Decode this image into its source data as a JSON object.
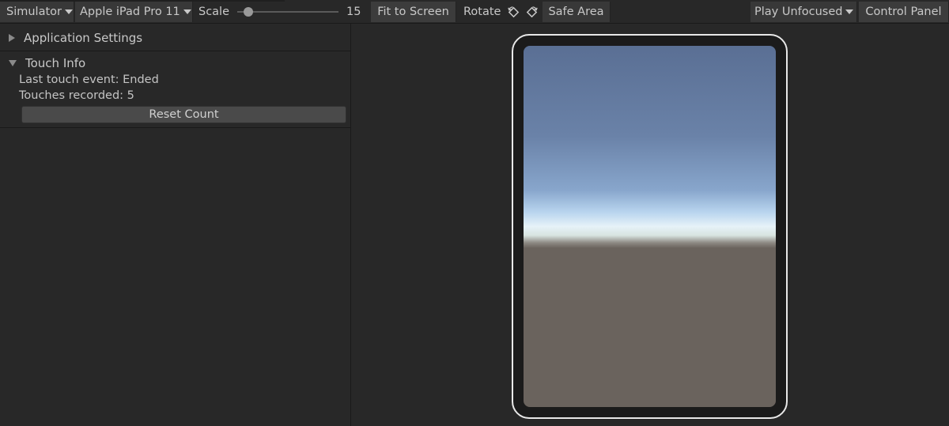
{
  "toolbar": {
    "mode_label": "Simulator",
    "device_label": "Apple iPad Pro 11",
    "scale_label": "Scale",
    "scale_value": "15",
    "fit_label": "Fit to Screen",
    "rotate_label": "Rotate",
    "safe_area_label": "Safe Area",
    "play_mode_label": "Play Unfocused",
    "control_panel_label": "Control Panel"
  },
  "panel": {
    "app_settings_label": "Application Settings",
    "touch_info_label": "Touch Info",
    "last_touch_text": "Last touch event: Ended",
    "touches_recorded_text": "Touches recorded: 5",
    "reset_label": "Reset Count"
  },
  "colors": {
    "background": "#282828",
    "toolbar_button": "#383838",
    "sky_top": "#5a6f94",
    "horizon": "#e6f2f8",
    "ground": "#6a635d"
  }
}
